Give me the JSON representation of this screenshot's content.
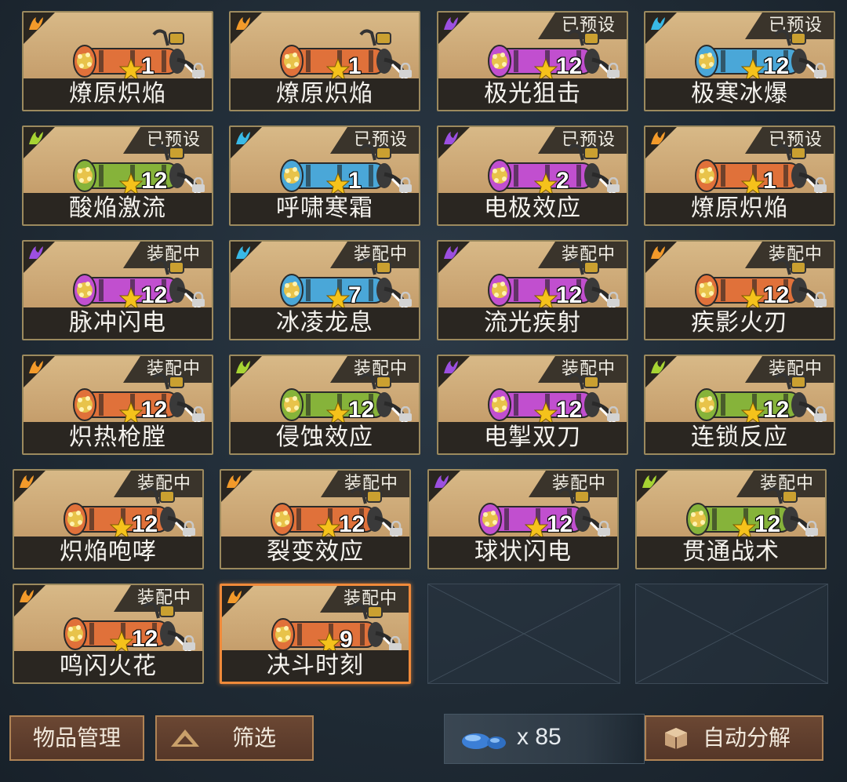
{
  "weapons": [
    {
      "name": "燎原炽焔",
      "level": "1",
      "tag": "",
      "element": "fire",
      "gun_color": "#e0713a",
      "selected": false
    },
    {
      "name": "燎原炽焔",
      "level": "1",
      "tag": "",
      "element": "fire",
      "gun_color": "#e0713a",
      "selected": false
    },
    {
      "name": "极光狙击",
      "level": "12",
      "tag": "已预设",
      "element": "purple",
      "gun_color": "#c14fcf",
      "selected": false
    },
    {
      "name": "极寒冰爆",
      "level": "12",
      "tag": "已预设",
      "element": "ice",
      "gun_color": "#4aa7d8",
      "selected": false
    },
    {
      "name": "酸焔激流",
      "level": "12",
      "tag": "已预设",
      "element": "acid",
      "gun_color": "#86b33a",
      "selected": false
    },
    {
      "name": "呼啸寒霜",
      "level": "1",
      "tag": "已预设",
      "element": "ice",
      "gun_color": "#4aa7d8",
      "selected": false
    },
    {
      "name": "电极效应",
      "level": "2",
      "tag": "已预设",
      "element": "purple",
      "gun_color": "#c14fcf",
      "selected": false
    },
    {
      "name": "燎原炽焔",
      "level": "1",
      "tag": "已预设",
      "element": "fire",
      "gun_color": "#e0713a",
      "selected": false
    },
    {
      "name": "脉冲闪电",
      "level": "12",
      "tag": "装配中",
      "element": "purple",
      "gun_color": "#c14fcf",
      "selected": false
    },
    {
      "name": "冰凌龙息",
      "level": "7",
      "tag": "装配中",
      "element": "ice",
      "gun_color": "#4aa7d8",
      "selected": false
    },
    {
      "name": "流光疾射",
      "level": "12",
      "tag": "装配中",
      "element": "purple",
      "gun_color": "#c14fcf",
      "selected": false
    },
    {
      "name": "疾影火刃",
      "level": "12",
      "tag": "装配中",
      "element": "fire",
      "gun_color": "#e0713a",
      "selected": false
    },
    {
      "name": "炽热枪膛",
      "level": "12",
      "tag": "装配中",
      "element": "fire",
      "gun_color": "#e0713a",
      "selected": false
    },
    {
      "name": "侵蚀效应",
      "level": "12",
      "tag": "装配中",
      "element": "acid",
      "gun_color": "#86b33a",
      "selected": false
    },
    {
      "name": "电掣双刀",
      "level": "12",
      "tag": "装配中",
      "element": "purple",
      "gun_color": "#c14fcf",
      "selected": false
    },
    {
      "name": "连锁反应",
      "level": "12",
      "tag": "装配中",
      "element": "acid",
      "gun_color": "#86b33a",
      "selected": false
    },
    {
      "name": "炽焔咆哮",
      "level": "12",
      "tag": "装配中",
      "element": "fire",
      "gun_color": "#e0713a",
      "selected": false
    },
    {
      "name": "裂变效应",
      "level": "12",
      "tag": "装配中",
      "element": "fire",
      "gun_color": "#e0713a",
      "selected": false
    },
    {
      "name": "球状闪电",
      "level": "12",
      "tag": "装配中",
      "element": "purple",
      "gun_color": "#c14fcf",
      "selected": false
    },
    {
      "name": "贯通战术",
      "level": "12",
      "tag": "装配中",
      "element": "acid",
      "gun_color": "#86b33a",
      "selected": false
    },
    {
      "name": "鸣闪火花",
      "level": "12",
      "tag": "装配中",
      "element": "fire",
      "gun_color": "#e0713a",
      "selected": false
    },
    {
      "name": "决斗时刻",
      "level": "9",
      "tag": "装配中",
      "element": "fire",
      "gun_color": "#e0713a",
      "selected": true
    }
  ],
  "element_colors": {
    "fire": "#f39a2a",
    "purple": "#9c4fe0",
    "ice": "#39b9e6",
    "acid": "#a7d433"
  },
  "bottom_bar": {
    "manage_label": "物品管理",
    "filter_label": "筛选",
    "currency_amount": "x 85",
    "currency_icon": "blue-crystal-icon",
    "auto_label": "自动分解"
  }
}
